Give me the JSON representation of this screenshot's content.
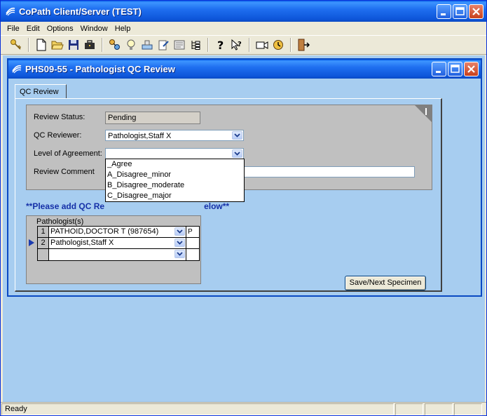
{
  "app": {
    "title": "CoPath Client/Server (TEST)"
  },
  "menu": [
    {
      "label": "File",
      "mnemonic": "F"
    },
    {
      "label": "Edit",
      "mnemonic": "E"
    },
    {
      "label": "Options",
      "mnemonic": "p"
    },
    {
      "label": "Window",
      "mnemonic": "W"
    },
    {
      "label": "Help",
      "mnemonic": "H"
    }
  ],
  "toolbar": {
    "icons": [
      "key-icon",
      "new-document-icon",
      "open-folder-icon",
      "save-icon",
      "briefcase-icon",
      "network-icon",
      "lightbulb-icon",
      "stamp-icon",
      "edit-document-icon",
      "form-icon",
      "tree-icon",
      "help-icon",
      "context-help-icon",
      "camera-icon",
      "clock-icon",
      "exit-icon"
    ]
  },
  "child": {
    "title": "PHS09-55 - Pathologist QC Review",
    "tab_label": "QC Review"
  },
  "form": {
    "review_status_label": "Review Status:",
    "review_status_value": "Pending",
    "qc_reviewer_label": "QC Reviewer:",
    "qc_reviewer_value": "Pathologist,Staff X",
    "level_label": "Level of Agreement:",
    "level_value": "",
    "review_comment_label": "Review Comment",
    "review_comment_value": ""
  },
  "level_options": [
    "_Agree",
    "A_Disagree_minor",
    "B_Disagree_moderate",
    "C_Disagree_major"
  ],
  "note": {
    "left": "**Please add QC Re",
    "right": "elow**"
  },
  "pathologists": {
    "group_label": "Pathologist(s)",
    "column_extra": "P",
    "rows": [
      {
        "num": "1",
        "name": "PATHOID,DOCTOR T (987654)"
      },
      {
        "num": "2",
        "name": "Pathologist,Staff X"
      },
      {
        "num": "",
        "name": ""
      }
    ]
  },
  "buttons": {
    "save_next": "Save/Next Specimen"
  },
  "status": {
    "text": "Ready"
  },
  "colors": {
    "titlebar": "#0d55d9",
    "mdi_background": "#a7cdf0",
    "note_text": "#1530a8"
  }
}
